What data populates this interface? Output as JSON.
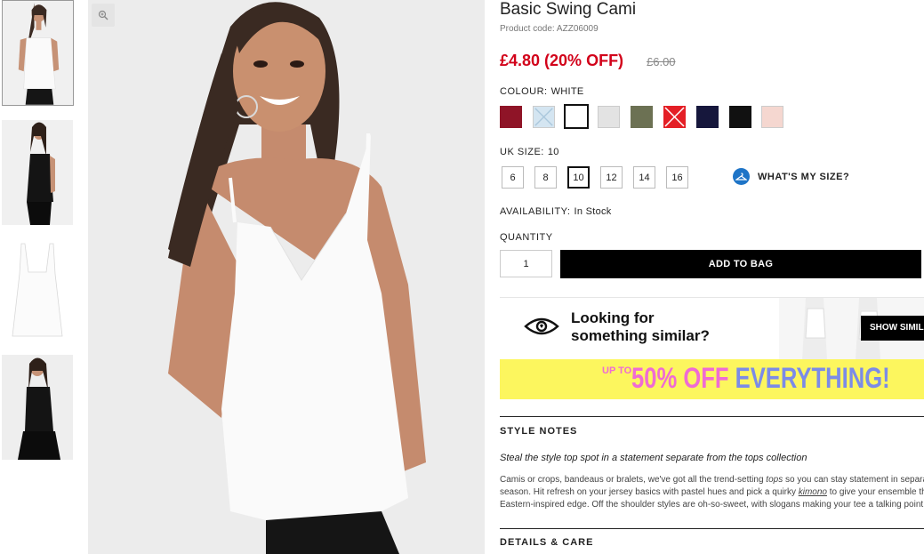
{
  "product": {
    "title": "Basic Swing Cami",
    "code": "Product code: AZZ06009",
    "price": "£4.80 (20% OFF)",
    "old_price": "£6.00"
  },
  "colour": {
    "label": "COLOUR:",
    "value": "WHITE",
    "swatches": [
      {
        "name": "burgundy",
        "hex": "#8f1427",
        "available": true
      },
      {
        "name": "light-blue",
        "hex": "#d4e5f1",
        "available": false
      },
      {
        "name": "white",
        "hex": "#ffffff",
        "available": true,
        "selected": true
      },
      {
        "name": "grey",
        "hex": "#e3e3e3",
        "available": true
      },
      {
        "name": "khaki",
        "hex": "#6c7153",
        "available": true
      },
      {
        "name": "red",
        "hex": "#e41f26",
        "available": false
      },
      {
        "name": "navy",
        "hex": "#16173c",
        "available": true
      },
      {
        "name": "black",
        "hex": "#111111",
        "available": true
      },
      {
        "name": "blush",
        "hex": "#f5d7d0",
        "available": true
      }
    ]
  },
  "size": {
    "label": "UK SIZE:",
    "value": "10",
    "options": [
      "6",
      "8",
      "10",
      "12",
      "14",
      "16"
    ],
    "guide_label": "WHAT'S MY SIZE?"
  },
  "availability": {
    "label": "AVAILABILITY:",
    "value": "In Stock"
  },
  "quantity": {
    "label": "QUANTITY",
    "value": "1"
  },
  "add_to_bag": "ADD TO BAG",
  "similar": {
    "line1": "Looking for",
    "line2": "something similar?",
    "button": "SHOW SIMILAR"
  },
  "promo": {
    "upto": "UP TO",
    "text_a": "50% OFF ",
    "text_b": "EVERYTHING!"
  },
  "style_notes": {
    "heading": "STYLE NOTES",
    "tagline": "Steal the style top spot in a statement separate from the tops collection",
    "lines": [
      {
        "a": "Camis or crops, bandeaus or bralets, we've got all the trend-setting ",
        "link": "tops",
        "b": " so you can stay statement in separates this"
      },
      {
        "a": "season. Hit refresh on your jersey basics with pastel hues and pick a quirky ",
        "link": "kimono",
        "b": " to give your ensemble that"
      },
      {
        "a": "Eastern-inspired edge. Off the shoulder styles are oh-so-sweet, with slogans making your tee a talking point.",
        "link": "",
        "b": ""
      }
    ]
  },
  "details_heading": "DETAILS & CARE"
}
